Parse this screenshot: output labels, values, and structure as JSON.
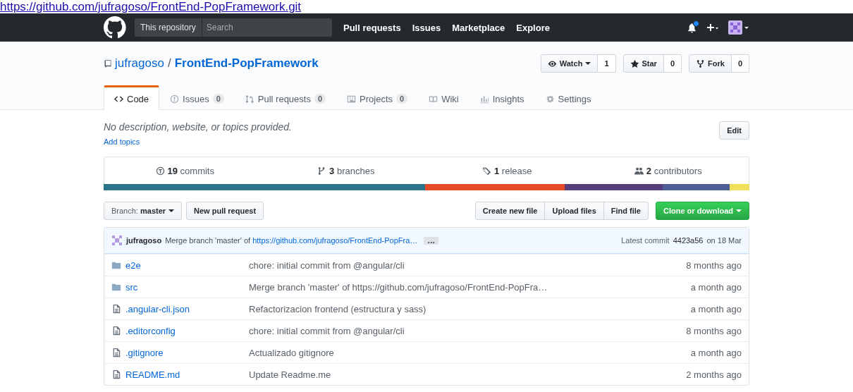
{
  "url_bar": {
    "text": "https://github.com/jufragoso/FrontEnd-PopFramework.git"
  },
  "nav": {
    "scope": "This repository",
    "search_placeholder": "Search",
    "links": [
      "Pull requests",
      "Issues",
      "Marketplace",
      "Explore"
    ],
    "notification_unread": true
  },
  "repo": {
    "owner": "jufragoso",
    "separator": "/",
    "name": "FrontEnd-PopFramework"
  },
  "repo_actions": [
    {
      "kind": "watch",
      "label": "Watch",
      "count": "1"
    },
    {
      "kind": "star",
      "label": "Star",
      "count": "0"
    },
    {
      "kind": "fork",
      "label": "Fork",
      "count": "0"
    }
  ],
  "tabs": [
    {
      "kind": "code",
      "label": "Code",
      "selected": true
    },
    {
      "kind": "issues",
      "label": "Issues",
      "count": "0",
      "selected": false
    },
    {
      "kind": "pulls",
      "label": "Pull requests",
      "count": "0",
      "selected": false
    },
    {
      "kind": "projects",
      "label": "Projects",
      "count": "0",
      "selected": false
    },
    {
      "kind": "wiki",
      "label": "Wiki",
      "selected": false
    },
    {
      "kind": "insights",
      "label": "Insights",
      "selected": false
    },
    {
      "kind": "settings",
      "label": "Settings",
      "selected": false
    }
  ],
  "description": "No description, website, or topics provided.",
  "edit_button": "Edit",
  "add_topics": "Add topics",
  "summary": [
    {
      "kind": "commits",
      "count": "19",
      "label": "commits"
    },
    {
      "kind": "branches",
      "count": "3",
      "label": "branches"
    },
    {
      "kind": "releases",
      "count": "1",
      "label": "release"
    },
    {
      "kind": "contributors",
      "count": "2",
      "label": "contributors"
    }
  ],
  "languages": [
    {
      "color": "#2b7489"
    },
    {
      "color": "#e34c26"
    },
    {
      "color": "#563d7c"
    },
    {
      "color": "#4f5d95"
    },
    {
      "color": "#f1e05a"
    }
  ],
  "branch": {
    "label": "Branch:",
    "value": "master"
  },
  "new_pr_button": "New pull request",
  "file_buttons": [
    "Create new file",
    "Upload files",
    "Find file"
  ],
  "clone_button": "Clone or download",
  "latest_commit": {
    "author": "jufragoso",
    "message": "Merge branch 'master' of ",
    "link": "https://github.com/jufragoso/FrontEnd-PopFra…",
    "more": "…",
    "label": "Latest commit",
    "sha": "4423a56",
    "date": "on 18 Mar"
  },
  "files": [
    {
      "kind": "dir",
      "name": "e2e",
      "message": "chore: initial commit from @angular/cli",
      "age": "8 months ago"
    },
    {
      "kind": "dir",
      "name": "src",
      "message": "Merge branch 'master' of https://github.com/jufragoso/FrontEnd-PopFra…",
      "age": "a month ago"
    },
    {
      "kind": "file",
      "name": ".angular-cli.json",
      "message": "Refactorizacion frontend (estructura y sass)",
      "age": "a month ago"
    },
    {
      "kind": "file",
      "name": ".editorconfig",
      "message": "chore: initial commit from @angular/cli",
      "age": "8 months ago"
    },
    {
      "kind": "file",
      "name": ".gitignore",
      "message": "Actualizado gitignore",
      "age": "a month ago"
    },
    {
      "kind": "file",
      "name": "README.md",
      "message": "Update Readme.me",
      "age": "2 months ago"
    }
  ]
}
